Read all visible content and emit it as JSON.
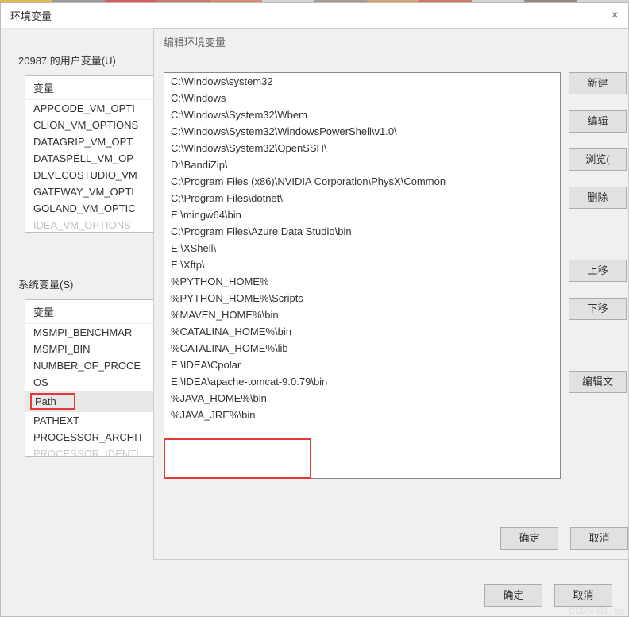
{
  "top_colors": [
    "#e8b84a",
    "#9c9c9c",
    "#d85c5c",
    "#c97b69",
    "#d78c6e",
    "#d4d4d4",
    "#a89a8c",
    "#d4a474",
    "#cc7864",
    "#d4d4d4",
    "#9c8878",
    "#d4d4d4"
  ],
  "main": {
    "title": "环境变量",
    "user_vars_label": "20987 的用户变量(U)",
    "sys_vars_label": "系统变量(S)",
    "col_header": "变量",
    "user_vars": [
      "APPCODE_VM_OPTI",
      "CLION_VM_OPTIONS",
      "DATAGRIP_VM_OPT",
      "DATASPELL_VM_OP",
      "DEVECOSTUDIO_VM",
      "GATEWAY_VM_OPTI",
      "GOLAND_VM_OPTIC"
    ],
    "user_vars_last_cut": "IDEA_VM_OPTIONS",
    "sys_vars": [
      "MSMPI_BENCHMAR",
      "MSMPI_BIN",
      "NUMBER_OF_PROCE",
      "OS",
      "Path",
      "PATHEXT",
      "PROCESSOR_ARCHIT"
    ],
    "sys_vars_last_cut": "PROCESSOR_IDENTI",
    "path_selected": "Path",
    "footer": {
      "ok": "确定",
      "cancel": "取消"
    }
  },
  "edit": {
    "title": "编辑环境变量",
    "paths": [
      "C:\\Windows\\system32",
      "C:\\Windows",
      "C:\\Windows\\System32\\Wbem",
      "C:\\Windows\\System32\\WindowsPowerShell\\v1.0\\",
      "C:\\Windows\\System32\\OpenSSH\\",
      "D:\\BandiZip\\",
      "C:\\Program Files (x86)\\NVIDIA Corporation\\PhysX\\Common",
      "C:\\Program Files\\dotnet\\",
      "E:\\mingw64\\bin",
      "C:\\Program Files\\Azure Data Studio\\bin",
      "E:\\XShell\\",
      "E:\\Xftp\\",
      "%PYTHON_HOME%",
      "%PYTHON_HOME%\\Scripts",
      "%MAVEN_HOME%\\bin",
      "%CATALINA_HOME%\\bin",
      "%CATALINA_HOME%\\lib",
      "E:\\IDEA\\Cpolar",
      "E:\\IDEA\\apache-tomcat-9.0.79\\bin",
      "%JAVA_HOME%\\bin",
      "%JAVA_JRE%\\bin"
    ],
    "buttons": {
      "new": "新建",
      "edit": "编辑",
      "browse": "浏览(",
      "delete": "删除",
      "up": "上移",
      "down": "下移",
      "edit_text": "编辑文"
    },
    "footer": {
      "ok": "确定",
      "cancel": "取消"
    }
  },
  "watermark": "CSDN @L_try"
}
